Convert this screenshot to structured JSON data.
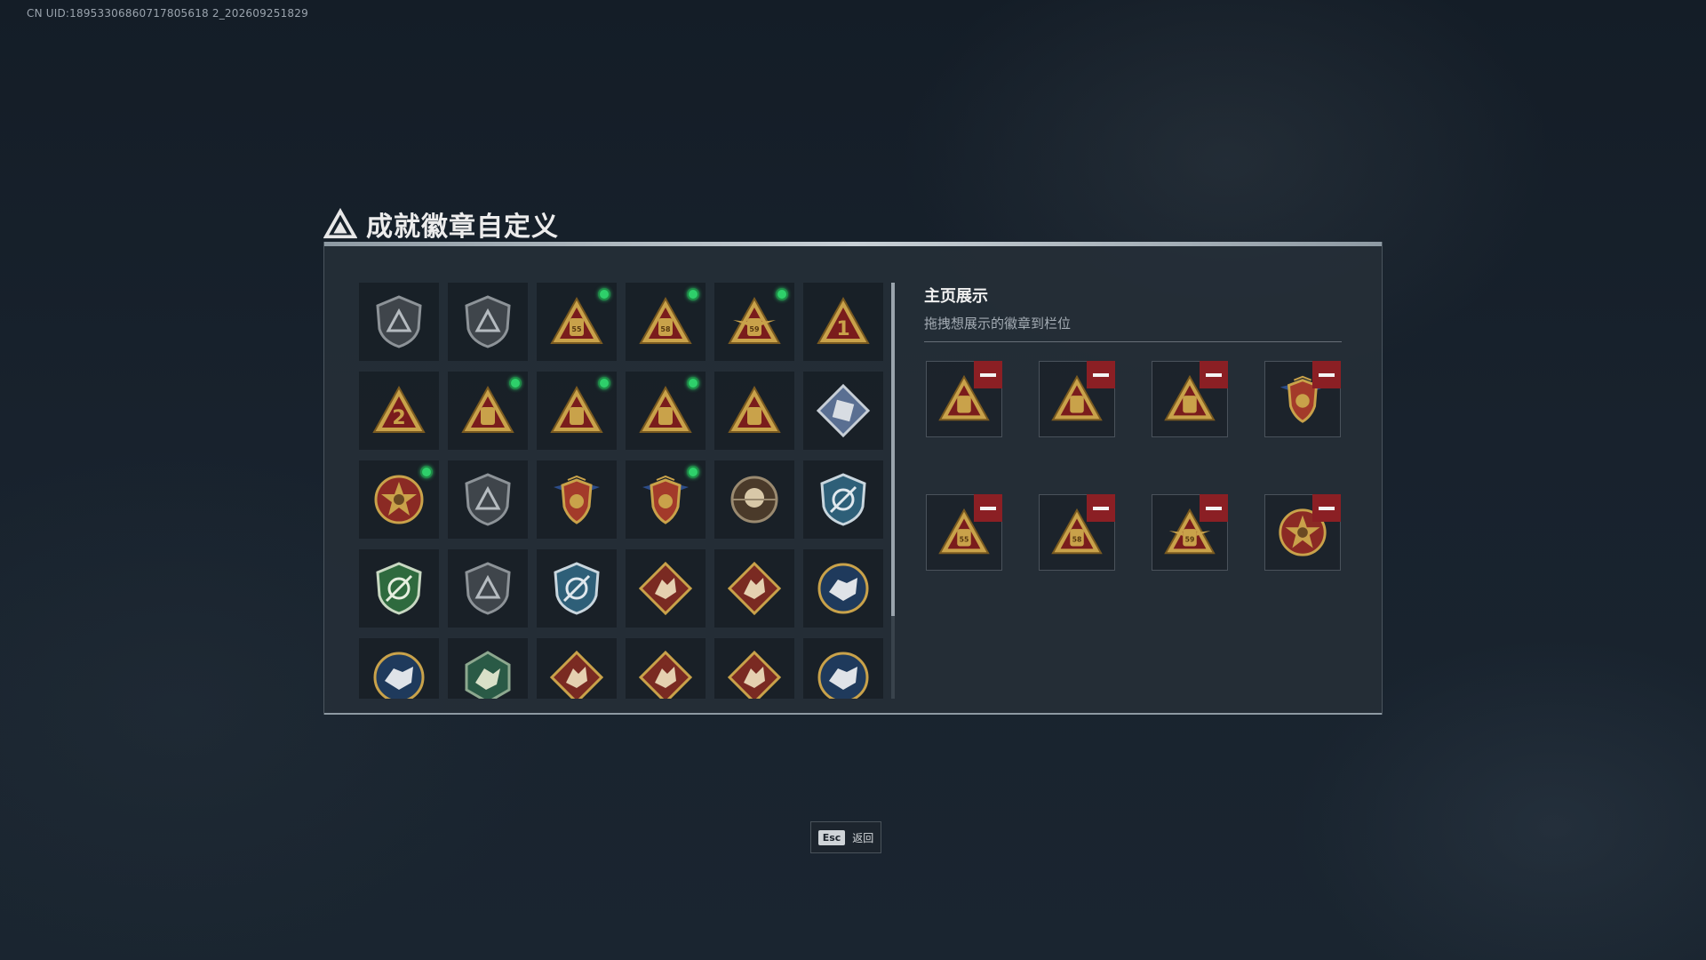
{
  "uid_text": "CN UID:18953306860717805618 2_202609251829",
  "title": "成就徽章自定义",
  "title_icon": "triangle-logo-icon",
  "right_panel": {
    "title": "主页展示",
    "subtitle": "拖拽想展示的徽章到栏位"
  },
  "badges": [
    {
      "icon": "grey-shield-triangle-badge-icon",
      "new": false
    },
    {
      "icon": "grey-shield-helicopter-badge-icon",
      "new": false
    },
    {
      "icon": "gold-triangle-55-badge-icon",
      "new": true,
      "text": "55"
    },
    {
      "icon": "gold-triangle-58-badge-icon",
      "new": true,
      "text": "58"
    },
    {
      "icon": "gold-triangle-59-winged-badge-icon",
      "new": true,
      "text": "59"
    },
    {
      "icon": "gold-triangle-number-1-badge-icon",
      "new": false,
      "text": "1"
    },
    {
      "icon": "gold-triangle-number-2-badge-icon",
      "new": false,
      "text": "2"
    },
    {
      "icon": "gold-triangle-canister-badge-icon",
      "new": true
    },
    {
      "icon": "gold-triangle-helmet-badge-icon",
      "new": true
    },
    {
      "icon": "gold-triangle-hands-badge-icon",
      "new": true
    },
    {
      "icon": "gold-triangle-soldiers-badge-icon",
      "new": false
    },
    {
      "icon": "silver-diamond-badge-icon",
      "new": false
    },
    {
      "icon": "star-skull-medal-badge-icon",
      "new": true
    },
    {
      "icon": "grey-shield-emblem-badge-icon",
      "new": false
    },
    {
      "icon": "winged-shield-badge-icon",
      "new": false
    },
    {
      "icon": "winged-shield-heart-badge-icon",
      "new": true
    },
    {
      "icon": "round-skull-badge-icon",
      "new": false
    },
    {
      "icon": "blue-shield-crosshair-badge-icon",
      "new": false
    },
    {
      "icon": "green-shield-crosshair-badge-icon",
      "new": false
    },
    {
      "icon": "grey-shield-knife-badge-icon",
      "new": false
    },
    {
      "icon": "blue-shield-swords-badge-icon",
      "new": false
    },
    {
      "icon": "red-diamond-wolf-badge-icon",
      "new": false
    },
    {
      "icon": "red-diamond-wolf-roar-badge-icon",
      "new": false
    },
    {
      "icon": "blue-circle-wolf-badge-icon",
      "new": false
    },
    {
      "icon": "blue-circle-dragon-badge-icon",
      "new": false
    },
    {
      "icon": "green-hexagon-dragon-badge-icon",
      "new": false
    },
    {
      "icon": "red-diamond-dragon-badge-icon",
      "new": false
    },
    {
      "icon": "red-diamond-dragon-2-badge-icon",
      "new": false
    },
    {
      "icon": "red-diamond-fighter-badge-icon",
      "new": false
    },
    {
      "icon": "blue-circle-beast-badge-icon",
      "new": false
    }
  ],
  "display_slots": [
    {
      "icon": "gold-triangle-helmet-badge-icon"
    },
    {
      "icon": "gold-triangle-canister-badge-icon"
    },
    {
      "icon": "gold-triangle-hands-badge-icon"
    },
    {
      "icon": "winged-shield-heart-badge-icon"
    },
    {
      "icon": "gold-triangle-55-badge-icon",
      "text": "55"
    },
    {
      "icon": "gold-triangle-58-badge-icon",
      "text": "58"
    },
    {
      "icon": "gold-triangle-59-winged-badge-icon",
      "text": "59"
    },
    {
      "icon": "star-skull-medal-badge-icon"
    }
  ],
  "esc": {
    "key": "Esc",
    "label": "返回"
  },
  "colors": {
    "new_indicator": "#2ed06a",
    "remove_button": "#8b1f24",
    "gold": "#c9a24a",
    "triangle_red": "#7a1c1c"
  }
}
